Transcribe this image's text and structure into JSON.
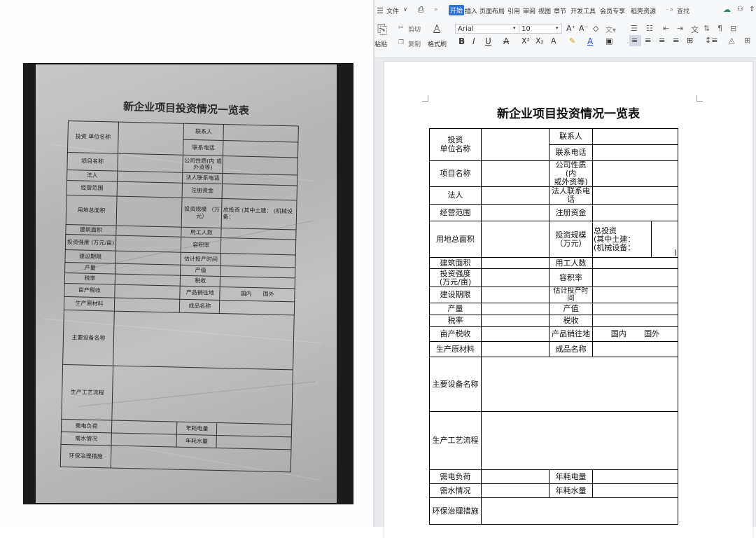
{
  "menubar": {
    "file_menu": "文件",
    "tabs": [
      "开始",
      "插入",
      "页面布局",
      "引用",
      "审阅",
      "视图",
      "章节",
      "开发工具",
      "会员专享",
      "稻壳资源"
    ],
    "search": "查找"
  },
  "toolbar": {
    "cut": "剪切",
    "copy": "复制",
    "paste": "粘贴",
    "format_painter": "格式刷",
    "font_name": "Arial",
    "font_size": "10"
  },
  "photo": {
    "title": "新企业项目投资情况一览表"
  },
  "document": {
    "title": "新企业项目投资情况一览表",
    "labels": {
      "investor_unit": "投资\n单位名称",
      "contact_person": "联系人",
      "contact_phone": "联系电话",
      "project_name": "项目名称",
      "company_nature": "公司性质(内\n或外资等)",
      "legal_person": "法人",
      "legal_phone": "法人联系电话",
      "business_scope": "经营范围",
      "registered_capital": "注册资金",
      "land_area": "用地总面积",
      "invest_scale": "投资规模\n（万元）",
      "total_invest": "总投资\n(其中土建：\n(机械设备：",
      "paren_close": ")",
      "building_area": "建筑面积",
      "workers": "用工人数",
      "invest_intensity": "投资强度\n(万元/亩)",
      "plot_ratio": "容积率",
      "build_period": "建设期限",
      "production_time": "估计投产时间",
      "output": "产量",
      "output_value": "产值",
      "tax_rate": "税率",
      "tax": "税收",
      "tax_per_mu": "亩产税收",
      "sales_region": "产品销往地",
      "domestic": "国内",
      "overseas": "国外",
      "raw_materials": "生产原材料",
      "product_name": "成品名称",
      "equipment": "主要设备名称",
      "process": "生产工艺流程",
      "power_load": "需电负荷",
      "annual_power": "年耗电量",
      "water_need": "需水情况",
      "annual_water": "年耗水量",
      "env_measures": "环保治理措施"
    }
  }
}
